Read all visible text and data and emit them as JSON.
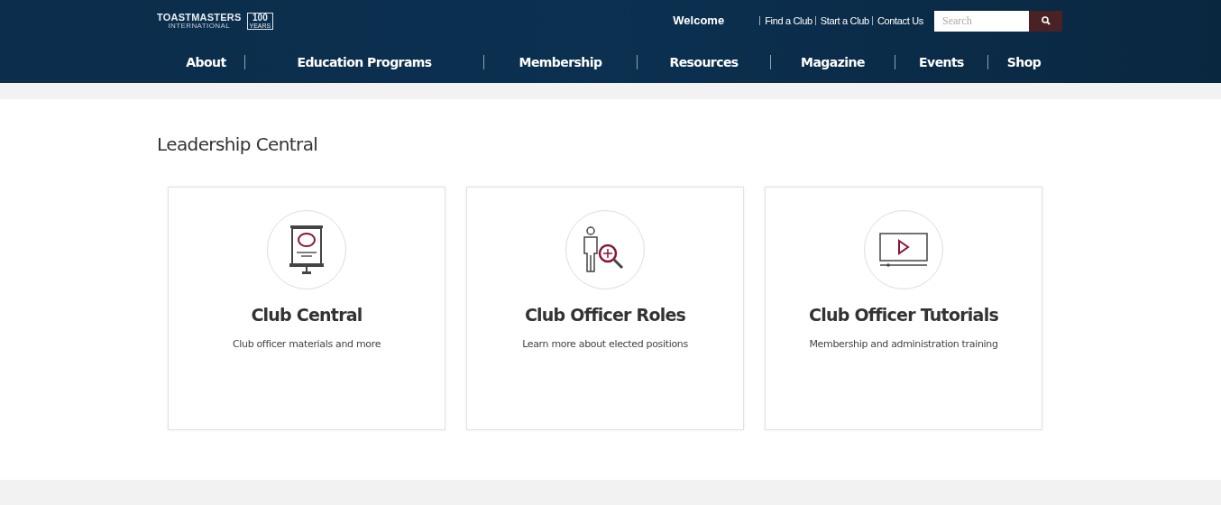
{
  "logo": {
    "name": "TOASTMASTERS",
    "sub": "INTERNATIONAL",
    "badge": "100",
    "badge_sub": "YEARS"
  },
  "welcome": "Welcome",
  "top_links": [
    "Find a Club",
    "Start a Club",
    "Contact Us"
  ],
  "search": {
    "placeholder": "Search"
  },
  "nav": [
    "About",
    "Education Programs",
    "Membership",
    "Resources",
    "Magazine",
    "Events",
    "Shop"
  ],
  "page_title": "Leadership Central",
  "cards": [
    {
      "kind": "presentation",
      "title": "Club Central",
      "description": "Club officer materials and more"
    },
    {
      "kind": "person-search",
      "title": "Club Officer Roles",
      "description": "Learn more about elected positions"
    },
    {
      "kind": "video",
      "title": "Club Officer Tutorials",
      "description": "Membership and administration training"
    }
  ]
}
